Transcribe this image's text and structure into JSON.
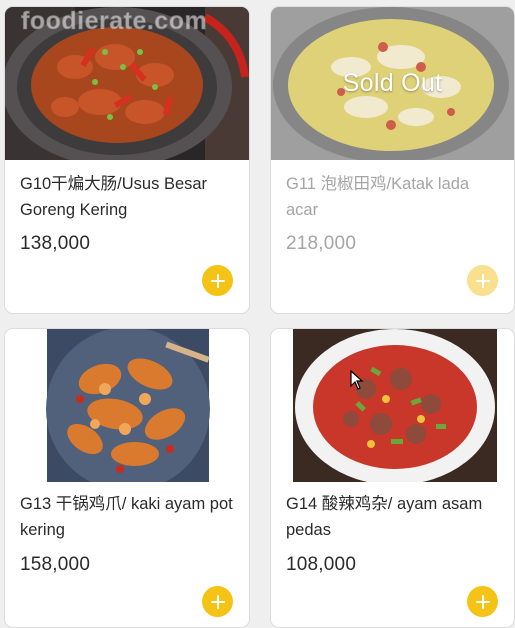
{
  "watermark": "foodierate.com",
  "items": [
    {
      "title": "G10干煸大肠/Usus Besar Goreng Kering",
      "price": "138,000",
      "sold_out": false,
      "status": ""
    },
    {
      "title": "G11 泡椒田鸡/Katak lada acar",
      "price": "218,000",
      "sold_out": true,
      "status": "Sold Out"
    },
    {
      "title": "G13 干锅鸡爪/ kaki ayam pot kering",
      "price": "158,000",
      "sold_out": false,
      "status": ""
    },
    {
      "title": "G14 酸辣鸡杂/ ayam asam pedas",
      "price": "108,000",
      "sold_out": false,
      "status": ""
    }
  ],
  "icons": {
    "add": "plus-icon",
    "cursor": "mouse-pointer-icon"
  },
  "colors": {
    "accent": "#f4c315",
    "accent_disabled": "#f9e08e",
    "text": "#2b2b2b",
    "text_disabled": "#a5a5a5"
  }
}
